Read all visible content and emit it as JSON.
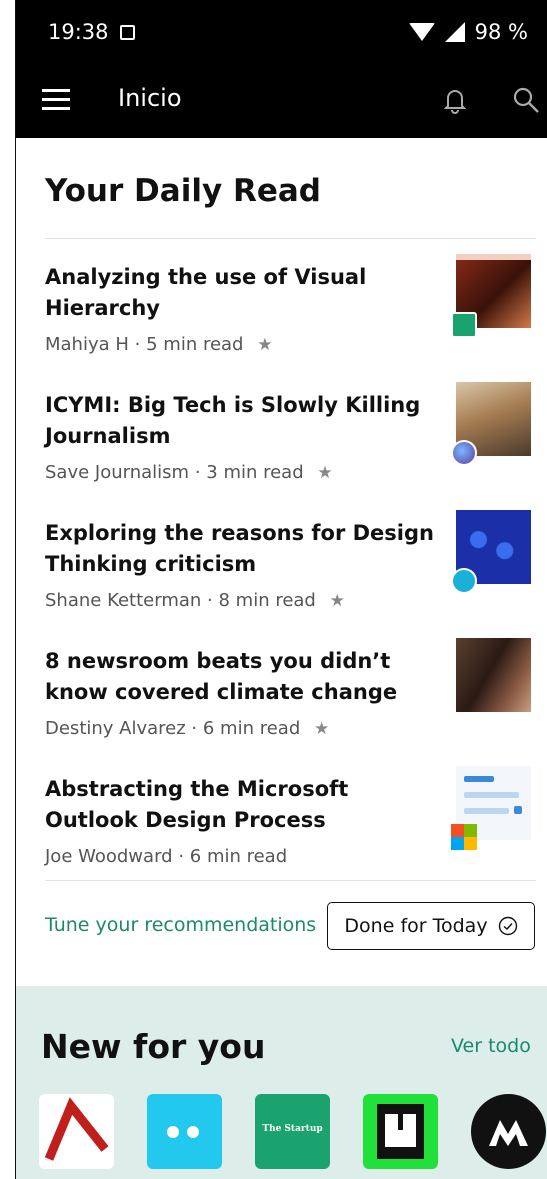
{
  "status_bar": {
    "time": "19:38",
    "battery": "98 %"
  },
  "app_bar": {
    "title": "Inicio"
  },
  "daily_read": {
    "title": "Your Daily Read",
    "articles": [
      {
        "title": "Analyzing the use of Visual Hierarchy",
        "author": "Mahiya H",
        "read_time": "5 min read",
        "starred": true
      },
      {
        "title": "ICYMI: Big Tech is Slowly Killing Journalism",
        "author": "Save Journalism",
        "read_time": "3 min read",
        "starred": true
      },
      {
        "title": "Exploring the reasons for Design Thinking criticism",
        "author": "Shane Ketterman",
        "read_time": "8 min read",
        "starred": true
      },
      {
        "title": "8 newsroom beats you didn’t know covered climate change",
        "author": "Destiny Alvarez",
        "read_time": "6 min read",
        "starred": true
      },
      {
        "title": "Abstracting the Microsoft Outlook Design Process",
        "author": "Joe Woodward",
        "read_time": "6 min read",
        "starred": false
      }
    ],
    "tune_link": "Tune your recommendations",
    "done_button": "Done for Today"
  },
  "new_for_you": {
    "title": "New for you",
    "see_all": "Ver todo",
    "startup_label": "The Startup"
  },
  "colors": {
    "accent": "#1a8a6b",
    "section_bg": "#dcedea"
  }
}
